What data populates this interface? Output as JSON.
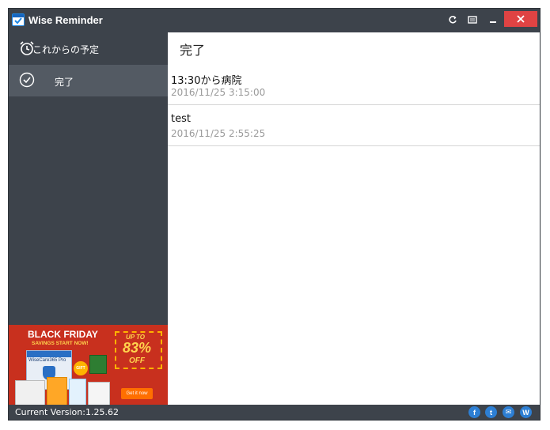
{
  "window": {
    "title": "Wise Reminder"
  },
  "titlebar": {
    "refresh_icon": "refresh-icon",
    "notes_icon": "notes-icon",
    "minimize_icon": "minimize-icon",
    "close_icon": "close-icon",
    "close_color": "#e04343"
  },
  "sidebar": {
    "items": [
      {
        "label": "これからの予定",
        "icon": "alarm-clock-icon",
        "active": false
      },
      {
        "label": "完了",
        "icon": "check-circle-icon",
        "active": true
      }
    ]
  },
  "ad": {
    "line1": "BLACK FRIDAY",
    "line2": "SAVINGS START NOW!",
    "up_to": "UP TO",
    "percent": "83%",
    "off": "OFF",
    "product": "WiseCare365 Pro",
    "gift": "GIFT",
    "cta": "Get it now"
  },
  "main": {
    "title": "完了",
    "items": [
      {
        "title": "13:30から病院",
        "date": "2016/11/25 3:15:00"
      },
      {
        "title": "test",
        "date": "2016/11/25 2:55:25"
      }
    ]
  },
  "statusbar": {
    "version": "Current Version:1.25.62",
    "social": [
      {
        "name": "facebook-icon",
        "glyph": "f"
      },
      {
        "name": "twitter-icon",
        "glyph": "t"
      },
      {
        "name": "email-icon",
        "glyph": "✉"
      },
      {
        "name": "wisecleaner-icon",
        "glyph": "W"
      }
    ]
  },
  "colors": {
    "sidebar_bg": "#3d434b",
    "sidebar_active": "#535a63",
    "accent": "#1e88e5",
    "date_text": "#9a9a9a"
  }
}
